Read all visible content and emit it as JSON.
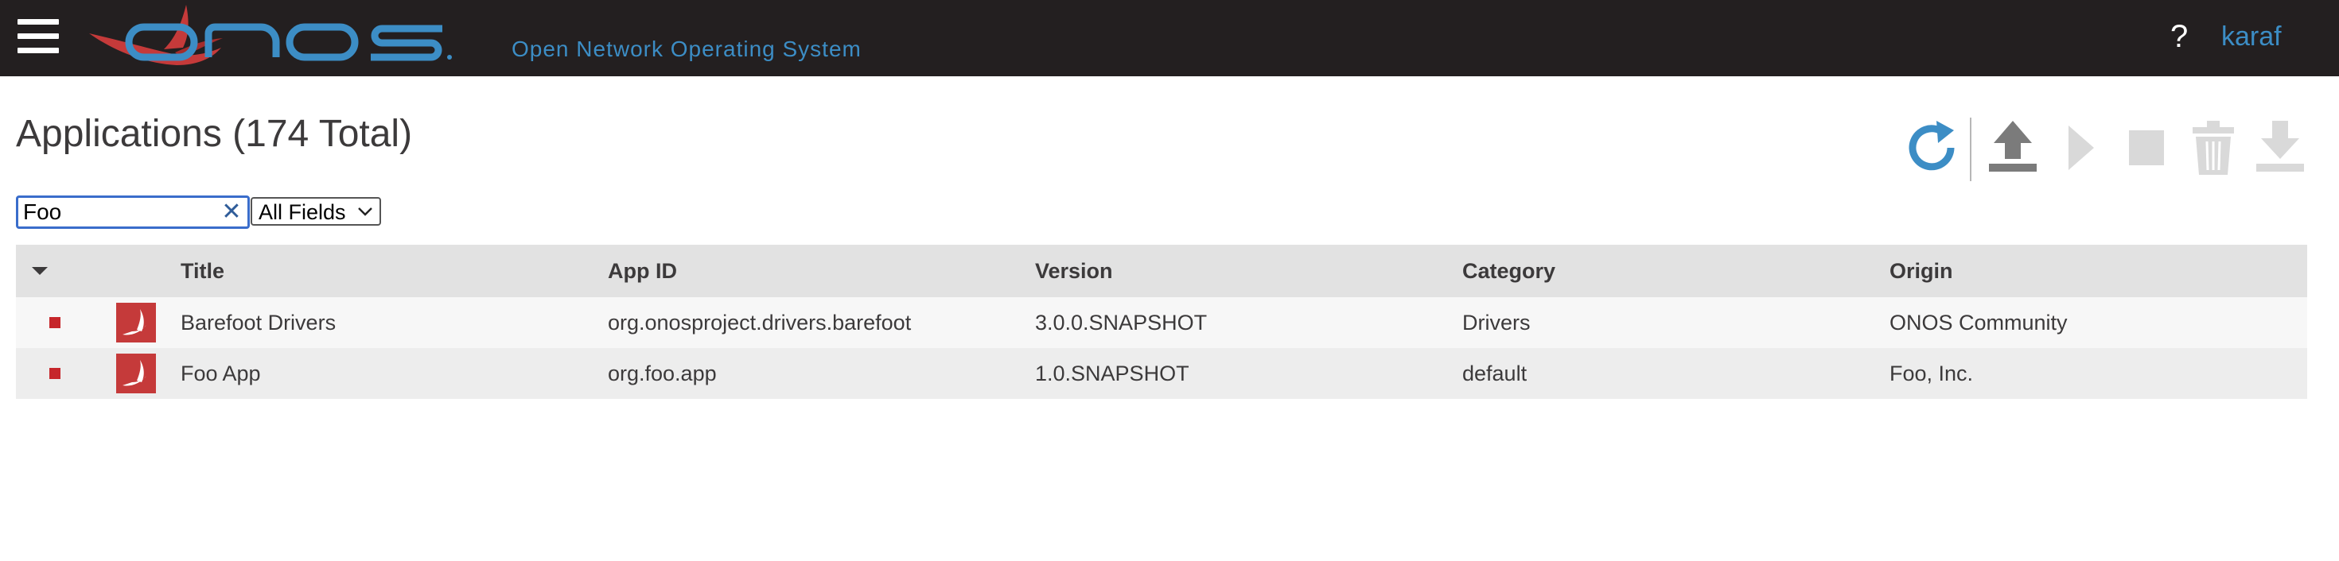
{
  "header": {
    "logo_text": "ONOS",
    "tagline": "Open Network Operating System",
    "help_label": "?",
    "user": "karaf"
  },
  "page": {
    "title": "Applications (174 Total)"
  },
  "toolbar": {
    "icons": [
      "refresh-icon",
      "upload-icon",
      "activate-icon",
      "deactivate-icon",
      "uninstall-icon",
      "download-icon"
    ]
  },
  "search": {
    "value": "Foo",
    "clear_icon": "close-icon",
    "field_selected": "All Fields"
  },
  "table": {
    "columns": [
      "Title",
      "App ID",
      "Version",
      "Category",
      "Origin"
    ],
    "rows": [
      {
        "title": "Barefoot Drivers",
        "app_id": "org.onosproject.drivers.barefoot",
        "version": "3.0.0.SNAPSHOT",
        "category": "Drivers",
        "origin": "ONOS Community",
        "state": "inactive"
      },
      {
        "title": "Foo App",
        "app_id": "org.foo.app",
        "version": "1.0.SNAPSHOT",
        "category": "default",
        "origin": "Foo, Inc.",
        "state": "inactive"
      }
    ]
  },
  "colors": {
    "masthead": "#231f20",
    "brand_blue": "#3c8dc5",
    "brand_red": "#c53a3a",
    "inactive_state": "#c6262b"
  }
}
